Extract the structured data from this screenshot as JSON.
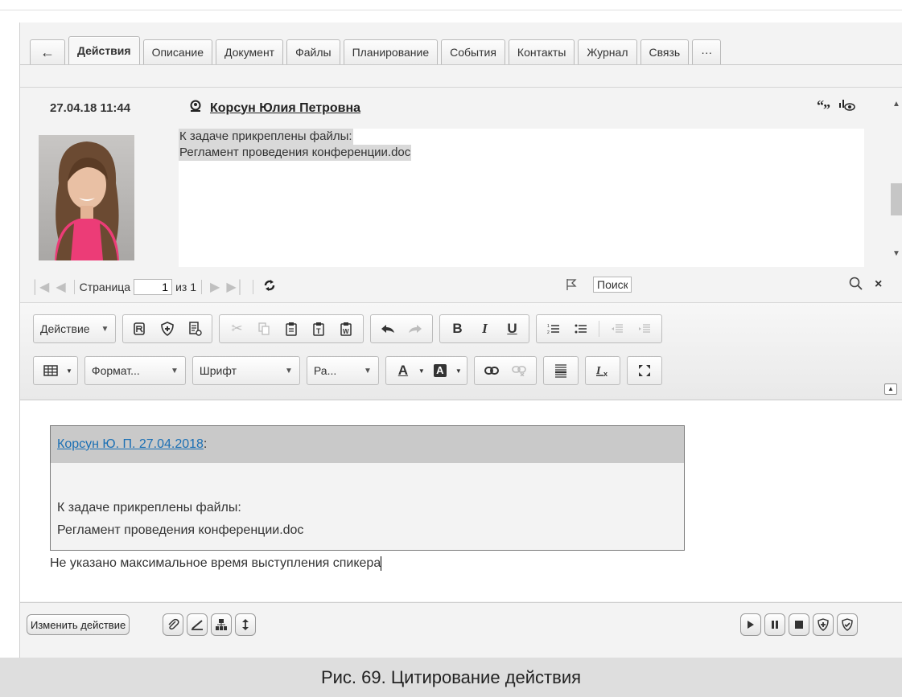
{
  "tabs": {
    "back": "←",
    "items": [
      "Действия",
      "Описание",
      "Документ",
      "Файлы",
      "Планирование",
      "События",
      "Контакты",
      "Журнал",
      "Связь",
      "···"
    ]
  },
  "message": {
    "date": "27.04.18 11:44",
    "author": "Корсун Юлия Петровна",
    "icons": "“” ❂",
    "lines": [
      "К задаче прикреплены файлы:",
      "Регламент проведения конференции.doc"
    ]
  },
  "pager": {
    "page_label": "Страница",
    "page_value": "1",
    "of_label": "из 1"
  },
  "search": {
    "value": "Поиск"
  },
  "toolbar": {
    "action_label": "Действие",
    "format_label": "Формат...",
    "font_label": "Шрифт",
    "size_label": "Ра...",
    "bold": "B",
    "italic": "I",
    "underline": "U",
    "text_color": "A",
    "bg_color": "A"
  },
  "editor": {
    "quote_author": "Корсун Ю. П. 27.04.2018",
    "quote_colon": ":",
    "quote_lines": [
      "К задаче прикреплены файлы:",
      "Регламент проведения конференции.doc"
    ],
    "text": "Не указано максимальное время выступления спикера"
  },
  "bottom": {
    "change_action_label": "Изменить действие"
  },
  "caption": "Рис. 69. Цитирование действия",
  "colors": {
    "link": "#1a6fb4",
    "highlight": "#d9d9d9"
  }
}
